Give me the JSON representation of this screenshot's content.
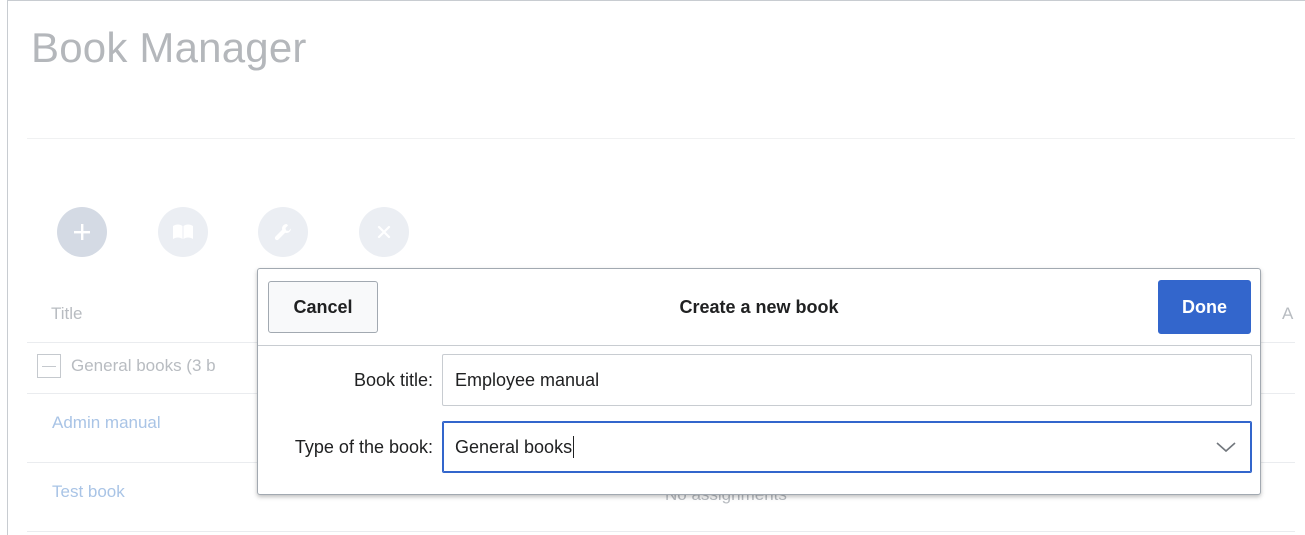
{
  "page": {
    "title": "Book Manager"
  },
  "toolbar": {
    "buttons": [
      {
        "name": "add",
        "icon": "plus-icon"
      },
      {
        "name": "book",
        "icon": "book-icon"
      },
      {
        "name": "settings",
        "icon": "wrench-icon"
      },
      {
        "name": "delete",
        "icon": "close-icon"
      }
    ]
  },
  "table": {
    "columns": [
      "Title",
      "A"
    ],
    "group_label": "General books (3 b",
    "rows": [
      {
        "title": "Admin manual"
      },
      {
        "title": "Test book",
        "assignments": "No assignments"
      }
    ]
  },
  "dialog": {
    "title": "Create a new book",
    "cancel_label": "Cancel",
    "done_label": "Done",
    "book_title_label": "Book title:",
    "book_title_value": "Employee manual",
    "type_label": "Type of the book:",
    "type_value": "General books"
  },
  "colors": {
    "accent": "#3366cc",
    "link": "#a9c4e6",
    "muted_text": "#b8bcc1"
  }
}
